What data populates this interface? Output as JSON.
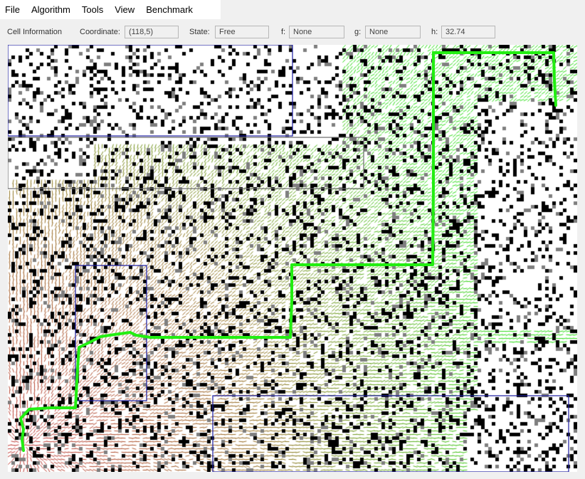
{
  "menu": {
    "file": "File",
    "algorithm": "Algorithm",
    "tools": "Tools",
    "view": "View",
    "benchmark": "Benchmark"
  },
  "info": {
    "title": "Cell Information",
    "coordinate_label": "Coordinate:",
    "coordinate_value": "(118,5)",
    "state_label": "State:",
    "state_value": "Free",
    "f_label": "f:",
    "f_value": "None",
    "g_label": "g:",
    "g_value": "None",
    "h_label": "h:",
    "h_value": "32.74"
  },
  "map": {
    "colors": {
      "free": "#ffffff",
      "obstacle": "#000000",
      "rough": "#7f7f7f",
      "expanded_near_start": "#c43e3e",
      "expanded_far": "#2fe01a",
      "path": "#22ee11",
      "region_border": "#1a1aa0"
    }
  }
}
